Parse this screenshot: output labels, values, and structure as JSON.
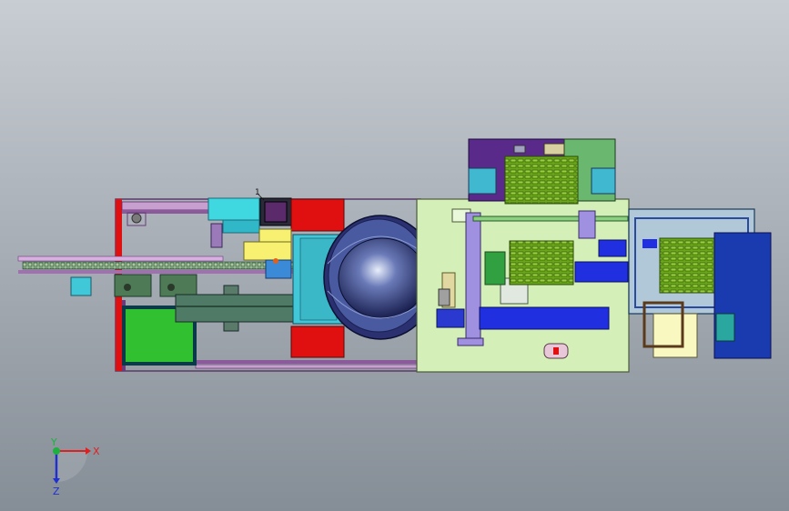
{
  "scene": {
    "background_top": "#c8cdd3",
    "background_bottom": "#858d96",
    "part_label": "1"
  },
  "triad": {
    "x_label": "X",
    "y_label": "Y",
    "z_label": "Z",
    "x_color": "#e02020",
    "y_color": "#20b040",
    "z_color": "#2030d0"
  },
  "colors": {
    "base_plate": "#d4f0b8",
    "frame_pink": "#c080b0",
    "red_block": "#e01010",
    "cyan_block": "#40d8e0",
    "green_block": "#30c030",
    "olive_rail": "#4e7a66",
    "lavender": "#a090e0",
    "blue_cyl": "#2030e0",
    "purple_box": "#5a2a8a",
    "green_coil": "#6aa818",
    "yellow": "#f8f070",
    "dark_blue": "#1a3ab0",
    "teal": "#2aa8a0",
    "dome": "#5a6aa8"
  }
}
